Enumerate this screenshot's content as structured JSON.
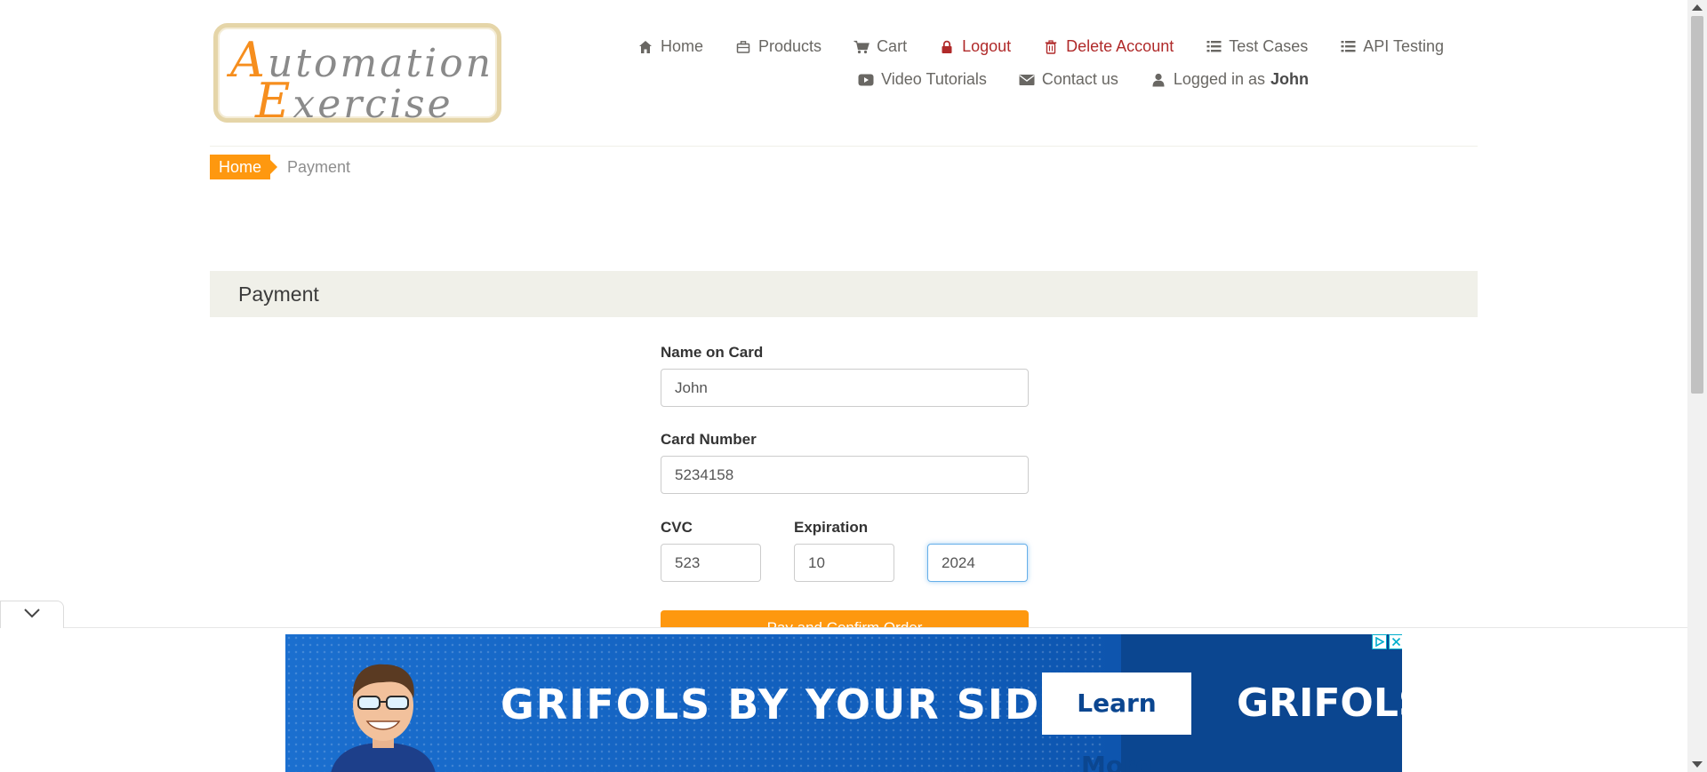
{
  "logo": {
    "line1_cap": "A",
    "line1_rest": "utomation",
    "line2_cap": "E",
    "line2_rest": "xercise"
  },
  "nav": {
    "row1": [
      {
        "label": "Home",
        "icon": "home-icon"
      },
      {
        "label": "Products",
        "icon": "briefcase-icon"
      },
      {
        "label": "Cart",
        "icon": "cart-icon"
      },
      {
        "label": "Logout",
        "icon": "lock-icon"
      },
      {
        "label": "Delete Account",
        "icon": "trash-icon"
      },
      {
        "label": "Test Cases",
        "icon": "list-icon"
      },
      {
        "label": "API Testing",
        "icon": "list-icon"
      }
    ],
    "row2": [
      {
        "label": "Video Tutorials",
        "icon": "youtube-play-icon"
      },
      {
        "label": "Contact us",
        "icon": "envelope-icon"
      },
      {
        "label": "Logged in as",
        "icon": "user-icon",
        "user": "John"
      }
    ]
  },
  "breadcrumb": {
    "home": "Home",
    "current": "Payment"
  },
  "payment": {
    "heading": "Payment",
    "name_label": "Name on Card",
    "name_value": "John",
    "card_label": "Card Number",
    "card_value": "5234158",
    "cvc_label": "CVC",
    "cvc_value": "523",
    "exp_label": "Expiration",
    "exp_month": "10",
    "exp_year": "2024",
    "submit_label": "Pay and Confirm Order"
  },
  "ad": {
    "headline": "GRIFOLS BY YOUR SIDE",
    "cta": "Learn More",
    "brand": "GRIFOLS"
  },
  "colors": {
    "accent": "#fe980f",
    "danger": "#b02a2a",
    "ad_blue": "#0f5bb8"
  }
}
